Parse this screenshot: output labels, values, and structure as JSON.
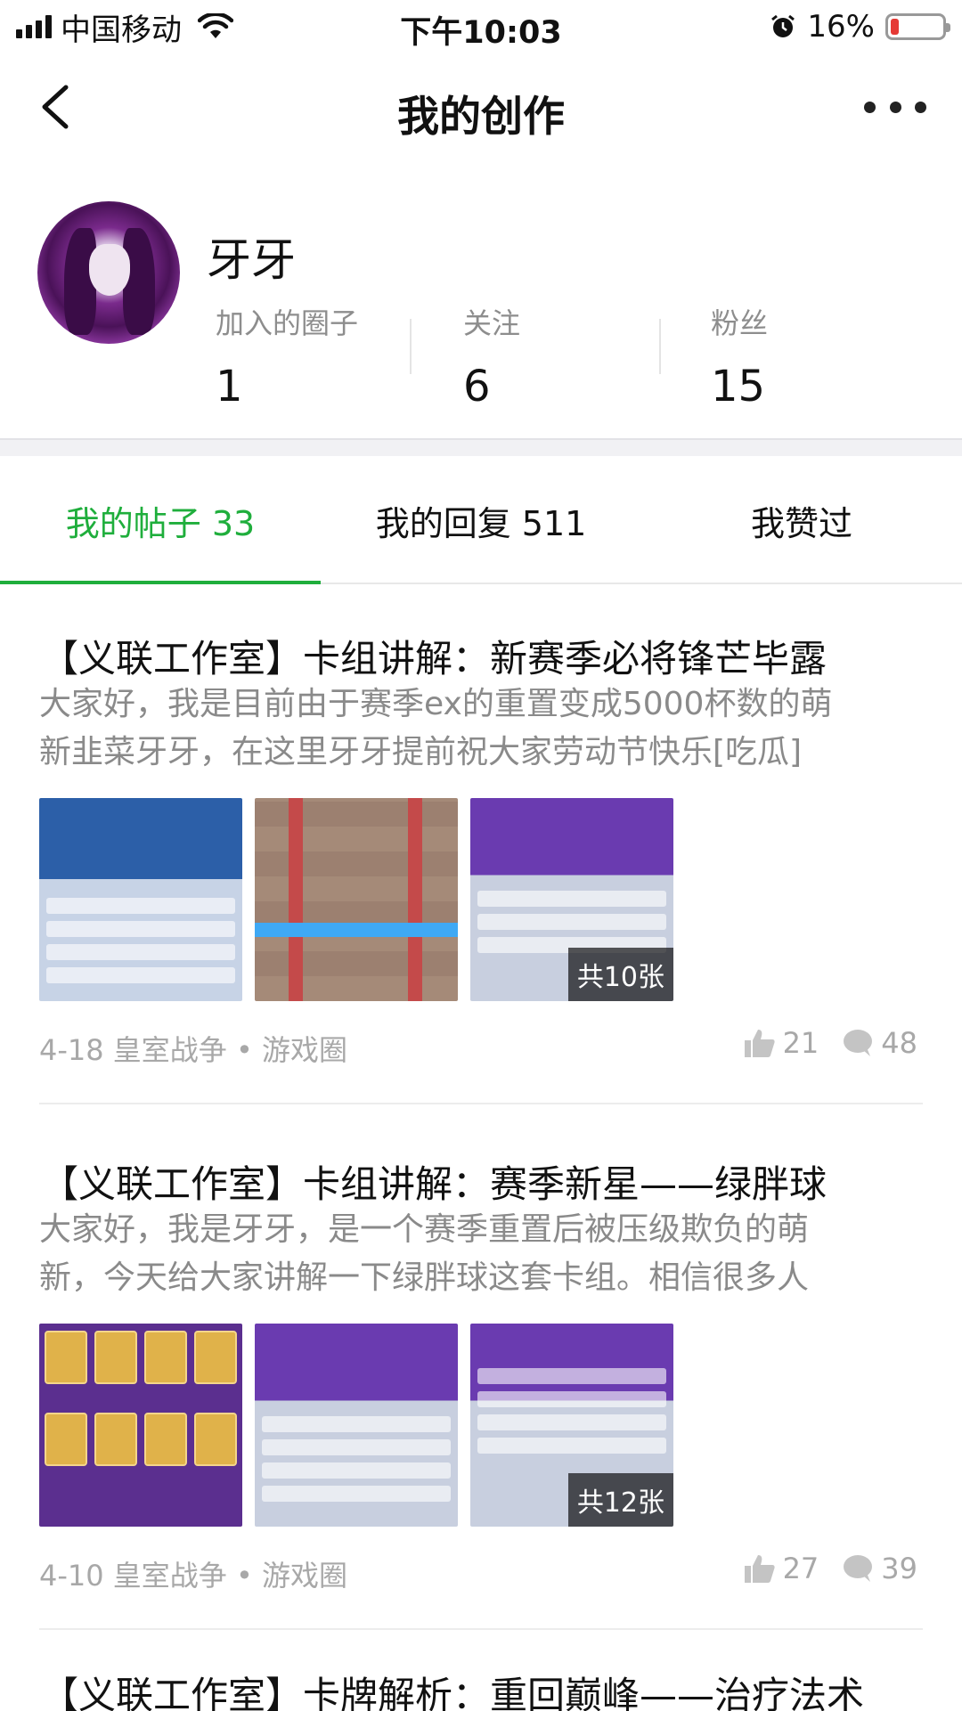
{
  "status_bar": {
    "carrier": "中国移动",
    "time": "下午10:03",
    "battery": "16%",
    "battery_level": 0.16,
    "icons": [
      "signal-icon",
      "wifi-icon",
      "alarm-icon",
      "battery-icon"
    ]
  },
  "nav": {
    "title": "我的创作",
    "icons": [
      "back-arrow-icon",
      "more-icon"
    ]
  },
  "profile": {
    "name": "牙牙",
    "stats": [
      {
        "label": "加入的圈子",
        "value": "1"
      },
      {
        "label": "关注",
        "value": "6"
      },
      {
        "label": "粉丝",
        "value": "15"
      }
    ]
  },
  "tabs": [
    {
      "label": "我的帖子 33",
      "active": true
    },
    {
      "label": "我的回复 511",
      "active": false
    },
    {
      "label": "我赞过",
      "active": false
    }
  ],
  "colors": {
    "accent": "#1fae3c",
    "secondary_text": "#8a8a8a",
    "battery_low": "#e53935"
  },
  "posts": [
    {
      "title": "【义联工作室】卡组讲解：新赛季必将锋芒毕露",
      "excerpt_lines": [
        "大家好，我是目前由于赛季ex的重置变成5000杯数的萌",
        "新韭菜牙牙，在这里牙牙提前祝大家劳动节快乐[吃瓜]"
      ],
      "image_count": "共10张",
      "meta": "4-18 皇室战争 • 游戏圈",
      "likes": "21",
      "comments": "48"
    },
    {
      "title": "【义联工作室】卡组讲解：赛季新星——绿胖球",
      "excerpt_lines": [
        "大家好，我是牙牙，是一个赛季重置后被压级欺负的萌",
        "新，今天给大家讲解一下绿胖球这套卡组。相信很多人"
      ],
      "image_count": "共12张",
      "meta": "4-10 皇室战争 • 游戏圈",
      "likes": "27",
      "comments": "39"
    },
    {
      "title": "【义联工作室】卡牌解析：重回巅峰——治疗法术"
    }
  ]
}
